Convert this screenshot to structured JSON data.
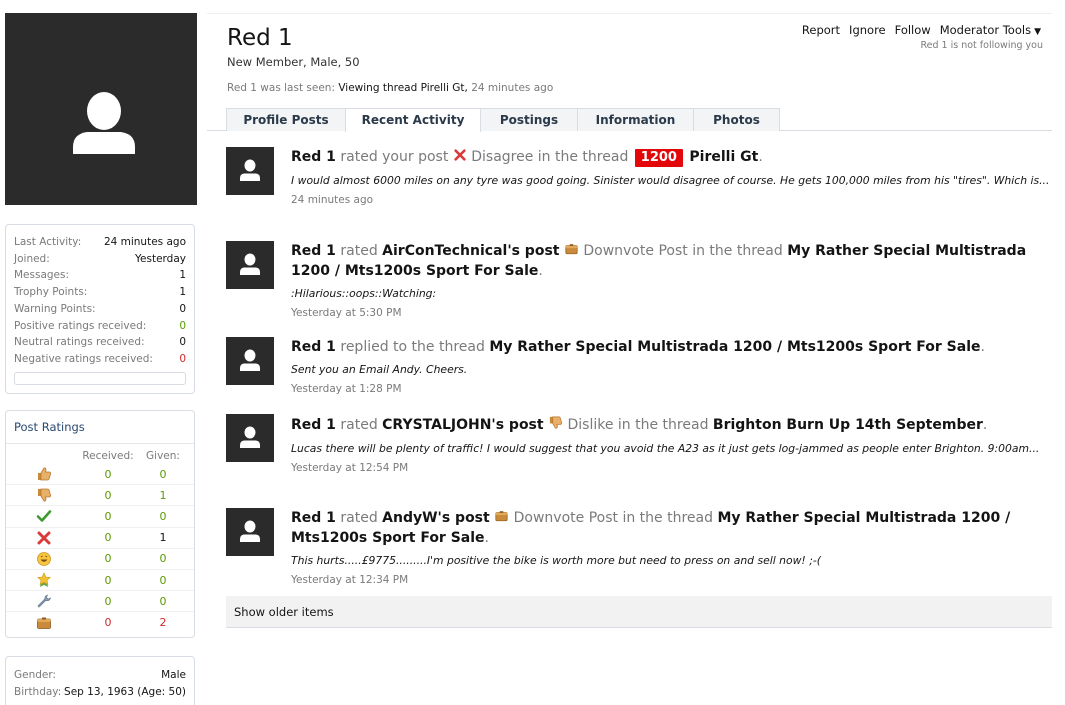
{
  "profile": {
    "name": "Red 1",
    "title": "New Member, Male, 50",
    "last_seen_prefix": "Red 1 was last seen:",
    "last_seen_activity": "Viewing thread Pirelli Gt,",
    "last_seen_time": "24 minutes ago"
  },
  "mod_links": {
    "report": "Report",
    "ignore": "Ignore",
    "follow": "Follow",
    "moderator_tools": "Moderator Tools",
    "follow_status": "Red 1 is not following you"
  },
  "tabs": [
    {
      "label": "Profile Posts"
    },
    {
      "label": "Recent Activity"
    },
    {
      "label": "Postings"
    },
    {
      "label": "Information"
    },
    {
      "label": "Photos"
    }
  ],
  "stats": [
    {
      "label": "Last Activity:",
      "value": "24 minutes ago"
    },
    {
      "label": "Joined:",
      "value": "Yesterday"
    },
    {
      "label": "Messages:",
      "value": "1"
    },
    {
      "label": "Trophy Points:",
      "value": "1"
    },
    {
      "label": "Warning Points:",
      "value": "0"
    },
    {
      "label": "Positive ratings received:",
      "value": "0"
    },
    {
      "label": "Neutral ratings received:",
      "value": "0"
    },
    {
      "label": "Negative ratings received:",
      "value": "0"
    }
  ],
  "post_ratings": {
    "title": "Post Ratings",
    "received_header": "Received:",
    "given_header": "Given:",
    "rows": [
      {
        "icon": "like-icon",
        "received": "0",
        "given": "0"
      },
      {
        "icon": "dislike-icon",
        "received": "0",
        "given": "1"
      },
      {
        "icon": "agree-icon",
        "received": "0",
        "given": "0"
      },
      {
        "icon": "disagree-icon",
        "received": "0",
        "given": "1"
      },
      {
        "icon": "funny-icon",
        "received": "0",
        "given": "0"
      },
      {
        "icon": "winner-icon",
        "received": "0",
        "given": "0"
      },
      {
        "icon": "useful-icon",
        "received": "0",
        "given": "0"
      },
      {
        "icon": "downvote-icon",
        "received": "0",
        "given": "2"
      }
    ]
  },
  "bio": [
    {
      "label": "Gender:",
      "value": "Male"
    },
    {
      "label": "Birthday:",
      "value": "Sep 13, 1963 (Age: 50)"
    }
  ],
  "activity": [
    {
      "user": "Red 1",
      "verb": "rated your post",
      "rating": "Disagree",
      "connector": "in the thread",
      "prefix": "1200",
      "thread": "Pirelli Gt",
      "end": ".",
      "snippet": "I would almost 6000 miles on any tyre was good going. Sinister would disagree of course. He gets 100,000 miles from his \"tires\". Which is...",
      "time": "24 minutes ago"
    },
    {
      "user": "Red 1",
      "verb": "rated",
      "target": "AirConTechnical's post",
      "rating": "Downvote Post",
      "connector": "in the thread",
      "thread": "My Rather Special Multistrada 1200 / Mts1200s Sport For Sale",
      "end": ".",
      "snippet": ":Hilarious::oops::Watching:",
      "time": "Yesterday at 5:30 PM"
    },
    {
      "user": "Red 1",
      "verb": "replied to the thread",
      "thread": "My Rather Special Multistrada 1200 / Mts1200s Sport For Sale",
      "end": ".",
      "snippet": "Sent you an Email Andy. Cheers.",
      "time": "Yesterday at 1:28 PM"
    },
    {
      "user": "Red 1",
      "verb": "rated",
      "target": "CRYSTALJOHN's post",
      "rating": "Dislike",
      "connector": "in the thread",
      "thread": "Brighton Burn Up 14th September",
      "end": ".",
      "snippet": "Lucas there will be plenty of traffic! I would suggest that you avoid the A23 as it just gets log-jammed as people enter Brighton. 9:00am...",
      "time": "Yesterday at 12:54 PM"
    },
    {
      "user": "Red 1",
      "verb": "rated",
      "target": "AndyW's post",
      "rating": "Downvote Post",
      "connector": "in the thread",
      "thread": "My Rather Special Multistrada 1200 / Mts1200s Sport For Sale",
      "end": ".",
      "snippet": "This hurts.....£9775.........I'm positive the bike is worth more but need to press on and sell now! ;-(",
      "time": "Yesterday at 12:34 PM"
    }
  ],
  "show_older": "Show older items"
}
